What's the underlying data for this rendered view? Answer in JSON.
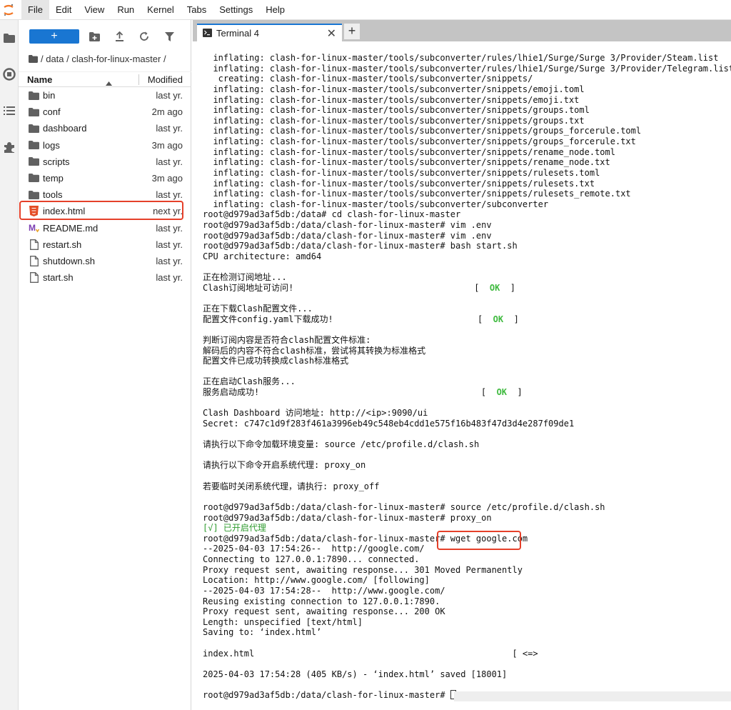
{
  "menubar": {
    "items": [
      "File",
      "Edit",
      "View",
      "Run",
      "Kernel",
      "Tabs",
      "Settings",
      "Help"
    ],
    "active": "File"
  },
  "activity_bar": {
    "icons": [
      "folder-icon",
      "running-icon",
      "commands-icon",
      "extensions-icon"
    ]
  },
  "filebrowser": {
    "new_label": "+",
    "breadcrumb": "/ data / clash-for-linux-master /",
    "columns": {
      "name": "Name",
      "modified": "Modified"
    },
    "files": [
      {
        "name": "bin",
        "modified": "last yr.",
        "icon": "folder-icon"
      },
      {
        "name": "conf",
        "modified": "2m ago",
        "icon": "folder-icon"
      },
      {
        "name": "dashboard",
        "modified": "last yr.",
        "icon": "folder-icon"
      },
      {
        "name": "logs",
        "modified": "3m ago",
        "icon": "folder-icon"
      },
      {
        "name": "scripts",
        "modified": "last yr.",
        "icon": "folder-icon"
      },
      {
        "name": "temp",
        "modified": "3m ago",
        "icon": "folder-icon"
      },
      {
        "name": "tools",
        "modified": "last yr.",
        "icon": "folder-icon"
      },
      {
        "name": "index.html",
        "modified": "next yr.",
        "icon": "html-file-icon"
      },
      {
        "name": "README.md",
        "modified": "last yr.",
        "icon": "markdown-file-icon"
      },
      {
        "name": "restart.sh",
        "modified": "last yr.",
        "icon": "file-icon"
      },
      {
        "name": "shutdown.sh",
        "modified": "last yr.",
        "icon": "file-icon"
      },
      {
        "name": "start.sh",
        "modified": "last yr.",
        "icon": "file-icon"
      }
    ]
  },
  "tabs": {
    "terminal_label": "Terminal 4",
    "close": "✕",
    "add": "+"
  },
  "colors": {
    "accent": "#1976d2",
    "highlight": "#e5402a",
    "ok": "#3fba3f"
  },
  "terminal": {
    "lines": [
      "  inflating: clash-for-linux-master/tools/subconverter/rules/lhie1/Surge/Surge 3/Provider/Steam.list",
      "  inflating: clash-for-linux-master/tools/subconverter/rules/lhie1/Surge/Surge 3/Provider/Telegram.list",
      "   creating: clash-for-linux-master/tools/subconverter/snippets/",
      "  inflating: clash-for-linux-master/tools/subconverter/snippets/emoji.toml",
      "  inflating: clash-for-linux-master/tools/subconverter/snippets/emoji.txt",
      "  inflating: clash-for-linux-master/tools/subconverter/snippets/groups.toml",
      "  inflating: clash-for-linux-master/tools/subconverter/snippets/groups.txt",
      "  inflating: clash-for-linux-master/tools/subconverter/snippets/groups_forcerule.toml",
      "  inflating: clash-for-linux-master/tools/subconverter/snippets/groups_forcerule.txt",
      "  inflating: clash-for-linux-master/tools/subconverter/snippets/rename_node.toml",
      "  inflating: clash-for-linux-master/tools/subconverter/snippets/rename_node.txt",
      "  inflating: clash-for-linux-master/tools/subconverter/snippets/rulesets.toml",
      "  inflating: clash-for-linux-master/tools/subconverter/snippets/rulesets.txt",
      "  inflating: clash-for-linux-master/tools/subconverter/snippets/rulesets_remote.txt",
      "  inflating: clash-for-linux-master/tools/subconverter/subconverter",
      "root@d979ad3af5db:/data# cd clash-for-linux-master",
      "root@d979ad3af5db:/data/clash-for-linux-master# vim .env",
      "root@d979ad3af5db:/data/clash-for-linux-master# vim .env",
      "root@d979ad3af5db:/data/clash-for-linux-master# bash start.sh",
      "CPU architecture: amd64",
      "",
      "正在检测订阅地址...",
      {
        "text": "Clash订阅地址可访问!                                   [  ",
        "ok": "OK",
        "after": "  ]"
      },
      "",
      "正在下载Clash配置文件...",
      {
        "text": "配置文件config.yaml下载成功!                            [  ",
        "ok": "OK",
        "after": "  ]"
      },
      "",
      "判断订阅内容是否符合clash配置文件标准:",
      "解码后的内容不符合clash标准，尝试将其转换为标准格式",
      "配置文件已成功转换成clash标准格式",
      "",
      "正在启动Clash服务...",
      {
        "text": "服务启动成功!                                           [  ",
        "ok": "OK",
        "after": "  ]"
      },
      "",
      "Clash Dashboard 访问地址: http://<ip>:9090/ui",
      "Secret: c747c1d9f283f461a3996eb49c548eb4cdd1e575f16b483f47d3d4e287f09de1",
      "",
      "请执行以下命令加载环境变量: source /etc/profile.d/clash.sh",
      "",
      "请执行以下命令开启系统代理: proxy_on",
      "",
      "若要临时关闭系统代理，请执行: proxy_off",
      "",
      "root@d979ad3af5db:/data/clash-for-linux-master# source /etc/profile.d/clash.sh",
      "root@d979ad3af5db:/data/clash-for-linux-master# proxy_on",
      {
        "green": "[√] 已开启代理"
      },
      "root@d979ad3af5db:/data/clash-for-linux-master# wget google.com",
      "--2025-04-03 17:54:26--  http://google.com/",
      "Connecting to 127.0.0.1:7890... connected.",
      "Proxy request sent, awaiting response... 301 Moved Permanently",
      "Location: http://www.google.com/ [following]",
      "--2025-04-03 17:54:28--  http://www.google.com/",
      "Reusing existing connection to 127.0.0.1:7890.",
      "Proxy request sent, awaiting response... 200 OK",
      "Length: unspecified [text/html]",
      "Saving to: ‘index.html’",
      "",
      "index.html                                                  [ <=>",
      "",
      "2025-04-03 17:54:28 (405 KB/s) - ‘index.html’ saved [18001]",
      "",
      {
        "prompt": "root@d979ad3af5db:/data/clash-for-linux-master# "
      }
    ]
  }
}
